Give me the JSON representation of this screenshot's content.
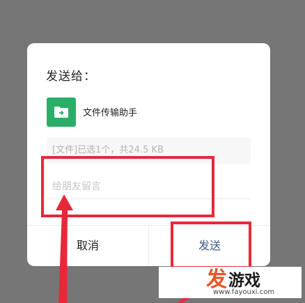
{
  "dialog": {
    "title": "发送给：",
    "recipient": {
      "name": "文件传输助手",
      "icon": "folder-icon",
      "icon_color": "#2aae67"
    },
    "file_info": "[文件]已选1个，共24.5 KB",
    "message": {
      "value": "",
      "placeholder": "给朋友留言"
    },
    "buttons": {
      "cancel": "取消",
      "send": "发送"
    }
  },
  "annotation_color": "#e8283a",
  "watermark": {
    "mark": "发",
    "name": "游戏",
    "url": "www.fayouxi.com"
  }
}
